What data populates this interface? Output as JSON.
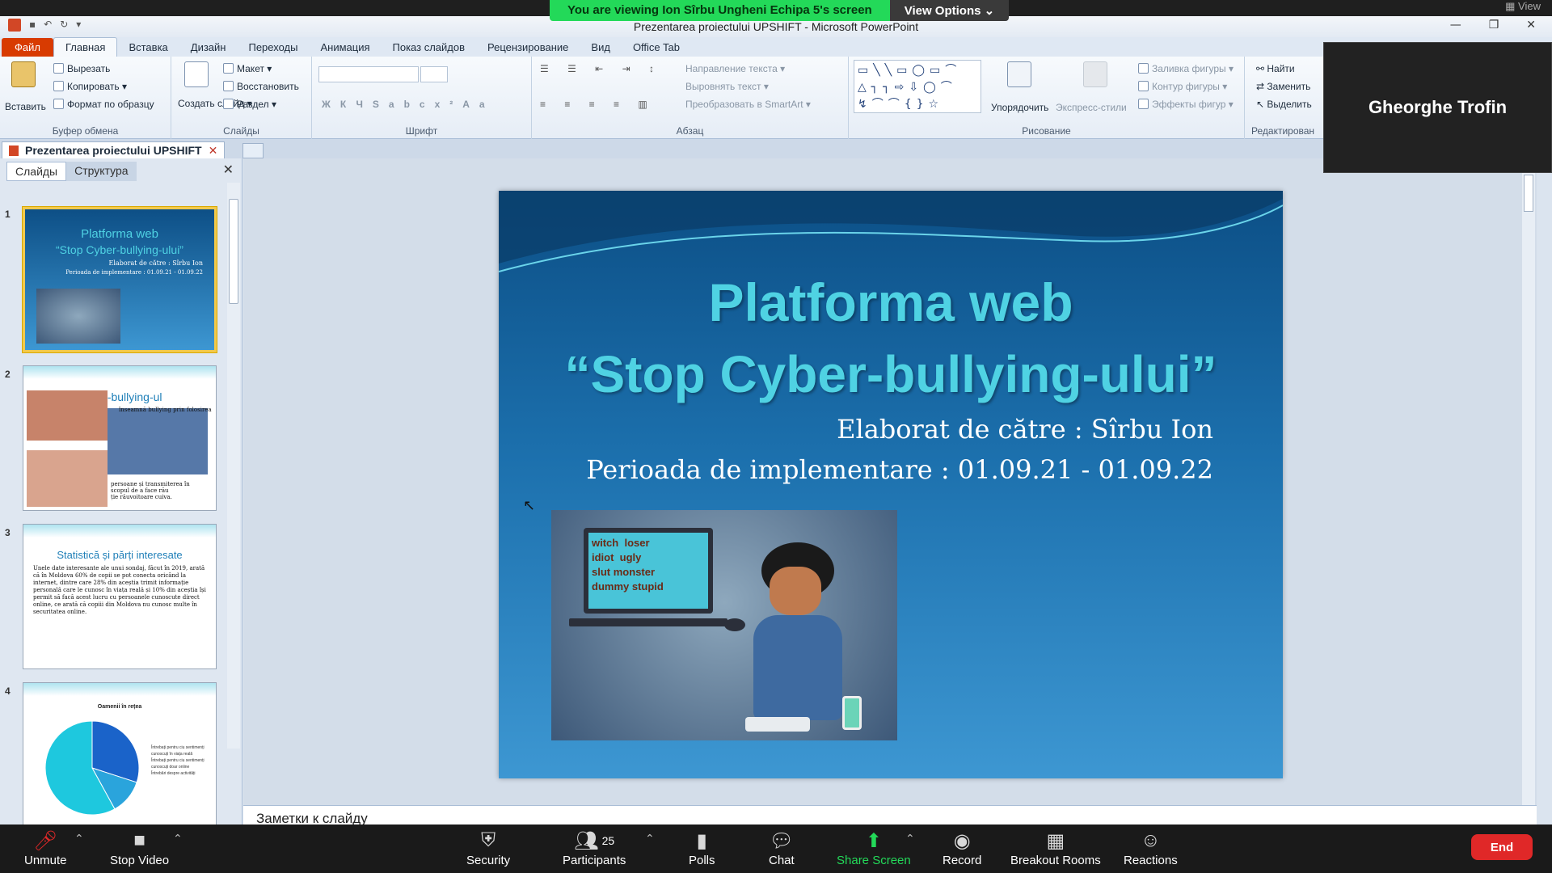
{
  "banner": {
    "viewing": "You are viewing Ion Sîrbu Ungheni Echipa 5's screen",
    "view_options": "View Options ⌄"
  },
  "window": {
    "title": "Prezentarea proiectului UPSHIFT  -  Microsoft PowerPoint",
    "view_label": "View"
  },
  "tabs": [
    "Файл",
    "Главная",
    "Вставка",
    "Дизайн",
    "Переходы",
    "Анимация",
    "Показ слайдов",
    "Рецензирование",
    "Вид",
    "Office Tab"
  ],
  "ribbon": {
    "clipboard": {
      "paste": "Вставить",
      "cut": "Вырезать",
      "copy": "Копировать",
      "format": "Формат по образцу",
      "label": "Буфер обмена"
    },
    "slides": {
      "new": "Создать слайд",
      "layout": "Макет",
      "reset": "Восстановить",
      "section": "Раздел",
      "label": "Слайды"
    },
    "font": {
      "label": "Шрифт"
    },
    "paragraph": {
      "direction": "Направление текста",
      "align": "Выровнять текст",
      "smartart": "Преобразовать в SmartArt",
      "label": "Абзац"
    },
    "drawing": {
      "arrange": "Упорядочить",
      "quick": "Экспресс-стили",
      "fill": "Заливка фигуры",
      "outline": "Контур фигуры",
      "effects": "Эффекты фигур",
      "label": "Рисование"
    },
    "editing": {
      "find": "Найти",
      "replace": "Заменить",
      "select": "Выделить",
      "label": "Редактирован"
    }
  },
  "doc_tab": "Prezentarea proiectului UPSHIFT",
  "panel": {
    "tab_slides": "Слайды",
    "tab_outline": "Структура"
  },
  "thumbs": [
    {
      "n": "1",
      "title": "Platforma web",
      "sub": "“Stop Cyber-bullying-ului”",
      "l1": "Elaborat de către : Sîrbu Ion",
      "l2": "Perioada de implementare : 01.09.21 - 01.09.22"
    },
    {
      "n": "2",
      "title": "Cyber-bullying-ul",
      "t1": "înseamnă bullying prin folosirea",
      "t2": "persoane și transmiterea în",
      "t3": "scopul de a face rău",
      "t4": "ție răuvoitoare cuiva."
    },
    {
      "n": "3",
      "title": "Statistică și părți interesate",
      "body": "Unele date interesante ale unui sondaj, făcut în 2019, arată că în Moldova 60% de copii se pot conecta oricând la internet, dintre care 28% din aceștia trimit informație personală care le cunosc în viața reală și 10% din aceștia își permit să facă acest lucru cu persoanele cunoscute direct online, ce arată că copiii din Moldova nu cunosc multe în securitatea online."
    },
    {
      "n": "4",
      "title": "Oamenii în rețea",
      "legend": [
        "Întrebați pentru ciu sentimenți cunoscuți în viața reală",
        "Întrebați pentru ciu sentimenți cunoscuți doar online",
        "Întrebări despre activități"
      ]
    }
  ],
  "slide": {
    "title1": "Platforma web",
    "title2": "“Stop Cyber-bullying-ului”",
    "author": "Elaborat de către : Sîrbu Ion",
    "period": "Perioada de implementare : 01.09.21 - 01.09.22",
    "words": [
      "witch",
      "loser",
      "idiot",
      "ugly",
      "slut",
      "monster",
      "dummy",
      "stupid"
    ]
  },
  "notes": "Заметки к слайду",
  "video_name": "Gheorghe Trofin",
  "zoom": {
    "unmute": "Unmute",
    "stop_video": "Stop Video",
    "security": "Security",
    "participants": "Participants",
    "participants_count": "25",
    "polls": "Polls",
    "chat": "Chat",
    "share": "Share Screen",
    "record": "Record",
    "breakout": "Breakout Rooms",
    "reactions": "Reactions",
    "end": "End"
  },
  "colors": {
    "accent": "#23d959",
    "end": "#e02828",
    "slide_title": "#4fd2e3"
  },
  "pie": [
    {
      "value": 30,
      "color": "#1a63c9"
    },
    {
      "value": 12,
      "color": "#2aa4dc"
    },
    {
      "value": 58,
      "color": "#1ec8de"
    }
  ]
}
